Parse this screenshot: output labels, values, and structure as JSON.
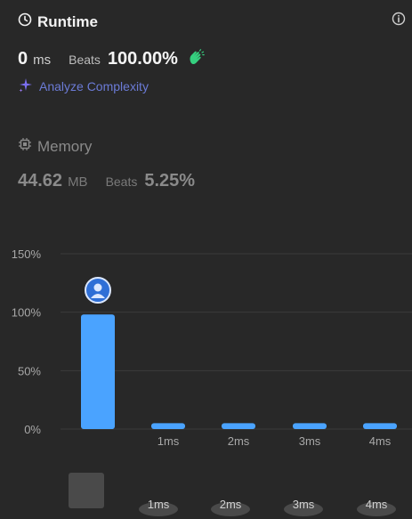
{
  "runtime": {
    "title": "Runtime",
    "value": "0",
    "unit": "ms",
    "beats_label": "Beats",
    "beats_value": "100.00%"
  },
  "analyze": {
    "label": "Analyze Complexity"
  },
  "memory": {
    "title": "Memory",
    "value": "44.62",
    "unit": "MB",
    "beats_label": "Beats",
    "beats_value": "5.25%"
  },
  "colors": {
    "bar": "#4aa3ff",
    "grid": "#3a3a3a",
    "axis_text": "#a8a8a8",
    "analyze": "#6b7bd6",
    "clap": "#35d07f"
  },
  "chart_data": {
    "type": "bar",
    "categories": [
      "",
      "1ms",
      "2ms",
      "3ms",
      "4ms"
    ],
    "values": [
      98,
      5,
      5,
      5,
      5
    ],
    "y_ticks": [
      "150%",
      "100%",
      "50%",
      "0%"
    ],
    "ylim": [
      0,
      150
    ],
    "grid": true,
    "highlighted_index": 0
  },
  "mini_overview": {
    "labels": [
      "1ms",
      "2ms",
      "3ms",
      "4ms"
    ]
  }
}
